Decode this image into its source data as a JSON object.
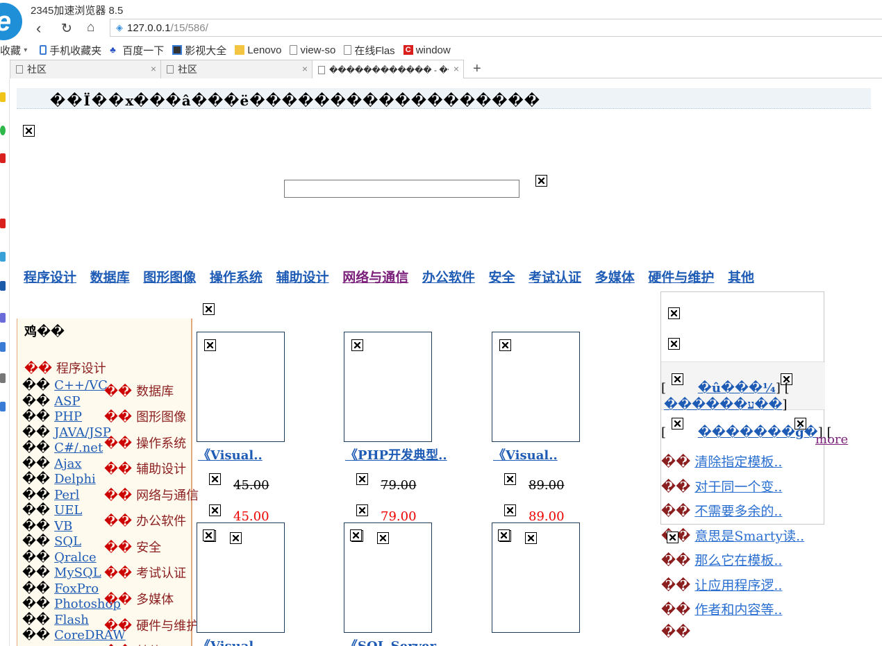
{
  "browser": {
    "title": "2345加速浏览器 8.5",
    "address": {
      "host": "127.0.0.1",
      "path": "/15/586/"
    },
    "bookmarks": {
      "prefix": "收藏",
      "items": [
        {
          "label": "手机收藏夹",
          "icon": "mobile-icon"
        },
        {
          "label": "百度一下",
          "icon": "baidu-paw-icon"
        },
        {
          "label": "影视大全",
          "icon": "film-icon"
        },
        {
          "label": "Lenovo",
          "icon": "folder-icon"
        },
        {
          "label": "view-so",
          "icon": "page-icon"
        },
        {
          "label": "在线Flas",
          "icon": "page-icon"
        },
        {
          "label": "window",
          "icon": "c-brand-icon"
        }
      ]
    },
    "tabs": [
      {
        "label": "社区"
      },
      {
        "label": "社区"
      },
      {
        "label": "������������ - ����"
      }
    ],
    "new_tab": "+"
  },
  "page": {
    "topbar": {
      "site_name": "��Ï��x",
      "welcome": "���â���ë������������������",
      "links": [
        "",
        "",
        "",
        ""
      ]
    },
    "main_nav": [
      "",
      "",
      ""
    ],
    "search": {
      "value": ""
    },
    "right_links": [
      "",
      ""
    ],
    "categories": [
      {
        "label": "程序设计"
      },
      {
        "label": "数据库"
      },
      {
        "label": "图形图像"
      },
      {
        "label": "操作系统"
      },
      {
        "label": "辅助设计"
      },
      {
        "label": "网络与通信",
        "visited": true
      },
      {
        "label": "办公软件"
      },
      {
        "label": "安全"
      },
      {
        "label": "考试认证"
      },
      {
        "label": "多媒体"
      },
      {
        "label": "硬件与维护"
      },
      {
        "label": "其他"
      }
    ],
    "sub_nav": [
      "",
      "",
      ""
    ],
    "sidebar": {
      "heading": "",
      "heading_2": "鸡��",
      "current_category": "程序设计",
      "subcategories": [
        "C++/VC",
        "ASP",
        "PHP",
        "JAVA/JSP",
        "C#/.net",
        "Ajax",
        "Delphi",
        "Perl",
        "UEL",
        "VB",
        "SQL",
        "Qralce",
        "MySQL",
        "FoxPro",
        "Photoshop",
        "Flash",
        "CoreDRAW"
      ],
      "other_categories": [
        "数据库",
        "图形图像",
        "操作系统",
        "辅助设计",
        "网络与通信",
        "办公软件",
        "安全",
        "考试认证",
        "多媒体",
        "硬件与维护",
        "其他"
      ]
    },
    "books": [
      {
        "title": "《Visual..",
        "old_price": "45.00",
        "new_price": "45.00"
      },
      {
        "title": "《PHP开发典型..",
        "old_price": "79.00",
        "new_price": "79.00"
      },
      {
        "title": "《Visual..",
        "old_price": "89.00",
        "new_price": "89.00"
      },
      {
        "title": "《Visual..."
      },
      {
        "title": "《SQL Server..."
      },
      {
        "title": ""
      }
    ],
    "price_labels": {
      "list": "",
      "sale": ""
    },
    "articles": {
      "heading": "",
      "more": "more",
      "items": [
        "清除指定模板..",
        "对于同一个变..",
        "不需要多余的..",
        "意思是Smarty读..",
        "那么它在模板..",
        "让应用程序逻..",
        "作者和内容等..",
        ""
      ]
    }
  }
}
